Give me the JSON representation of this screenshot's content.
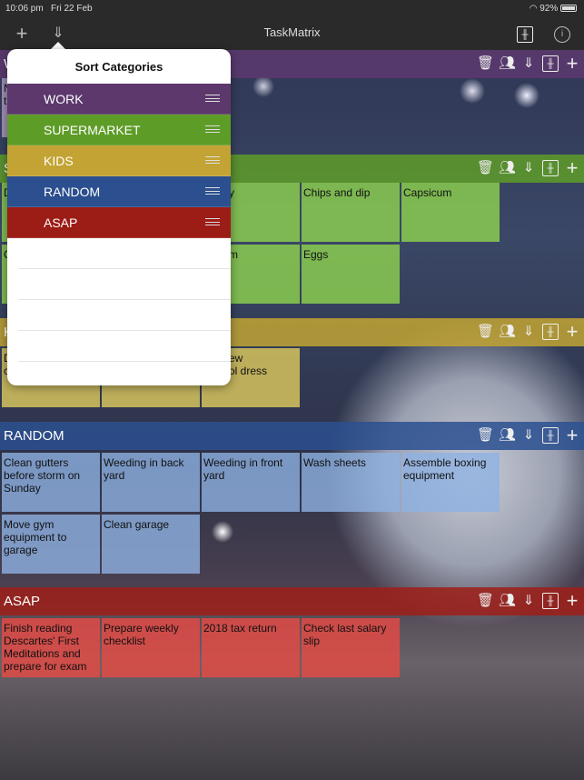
{
  "status": {
    "time": "10:06 pm",
    "date": "Fri 22 Feb",
    "battery": "92%",
    "battery_level": 92
  },
  "nav": {
    "title": "TaskMatrix",
    "add_icon": "plus-icon",
    "sort_icon": "sort-icon",
    "settings_icon": "sliders-icon",
    "info_icon": "info-icon"
  },
  "colors": {
    "work": "#5d3a70",
    "supermarket": "#5e9c28",
    "kids": "#c2a432",
    "random": "#2b5090",
    "asap": "#9e1e18"
  },
  "sections": [
    {
      "key": "work",
      "title": "W",
      "notes": [
        [
          "N\nt"
        ]
      ]
    },
    {
      "key": "supermarket",
      "title": "S",
      "notes": [
        [
          "D",
          "",
          "y",
          "Chips and dip",
          "Capsicum"
        ],
        [
          "C",
          "",
          "m",
          "Eggs"
        ]
      ]
    },
    {
      "key": "kids",
      "title": "K",
      "notes": [
        [
          "D\nc",
          "",
          "ew\nol dress"
        ]
      ]
    },
    {
      "key": "random",
      "title": "RANDOM",
      "notes": [
        [
          "Clean gutters before storm on Sunday",
          "Weeding in back yard",
          "Weeding in front yard",
          "Wash sheets",
          "Assemble boxing equipment"
        ],
        [
          "Move gym equipment to garage",
          "Clean garage"
        ]
      ]
    },
    {
      "key": "asap",
      "title": "ASAP",
      "notes": [
        [
          "Finish reading Descartes' First Meditations and prepare for exam",
          "Prepare weekly checklist",
          "2018 tax return",
          "Check last salary slip"
        ]
      ]
    }
  ],
  "popover": {
    "title": "Sort Categories",
    "items": [
      {
        "label": "WORK",
        "color": "#5c386c"
      },
      {
        "label": "SUPERMARKET",
        "color": "#5e9c28"
      },
      {
        "label": "KIDS",
        "color": "#c3a333"
      },
      {
        "label": "RANDOM",
        "color": "#2b4f8f"
      },
      {
        "label": "ASAP",
        "color": "#9c1c16"
      }
    ],
    "empty_rows": 5
  }
}
